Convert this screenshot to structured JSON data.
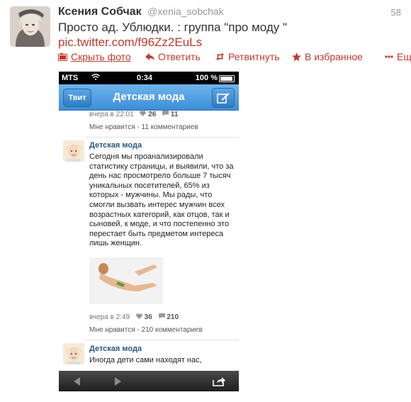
{
  "tweet": {
    "author_name": "Ксения Собчак",
    "author_handle": "@xenia_sobchak",
    "time": "58",
    "text": "Просто ад. Ублюдки. : группа \"про моду \"",
    "link": "pic.twitter.com/f96Zz2EuLs",
    "accent_color": "#c0392b"
  },
  "actions": {
    "hide_photo": "Скрыть фото",
    "reply": "Ответить",
    "retweet": "Ретвитнуть",
    "favorite": "В избранное",
    "more": "Ещё"
  },
  "phone": {
    "status": {
      "carrier": "MTS",
      "time": "0:34",
      "battery": "100 %"
    },
    "nav": {
      "back": "Твит",
      "title": "Детская мода"
    },
    "first_post": {
      "time": "вчера в 22:01",
      "likes": "26",
      "comments": "11",
      "summary": "Мне нравится - 11 комментариев"
    },
    "second_post": {
      "author": "Детская мода",
      "text": "Сегодня мы проанализировали статистику страницы, и выявили, что за день нас просмотрело больше 7 тысяч уникальных посетителей, 65% из которых - мужчины. Мы рады, что смогли вызвать интерес мужчин всех возрастных категорий, как отцов, так и сыновей, к моде, и что постепенно это перестает быть предметом интереса лишь женщин.",
      "time": "вчера в 2:49",
      "likes": "36",
      "comments": "210",
      "summary": "Мне нравится - 210 комментариев"
    },
    "third_post": {
      "author": "Детская мода",
      "text": "Иногда дети сами находят нас,"
    },
    "nav_color": "#3d8ed6",
    "link_color": "#2b587a"
  }
}
